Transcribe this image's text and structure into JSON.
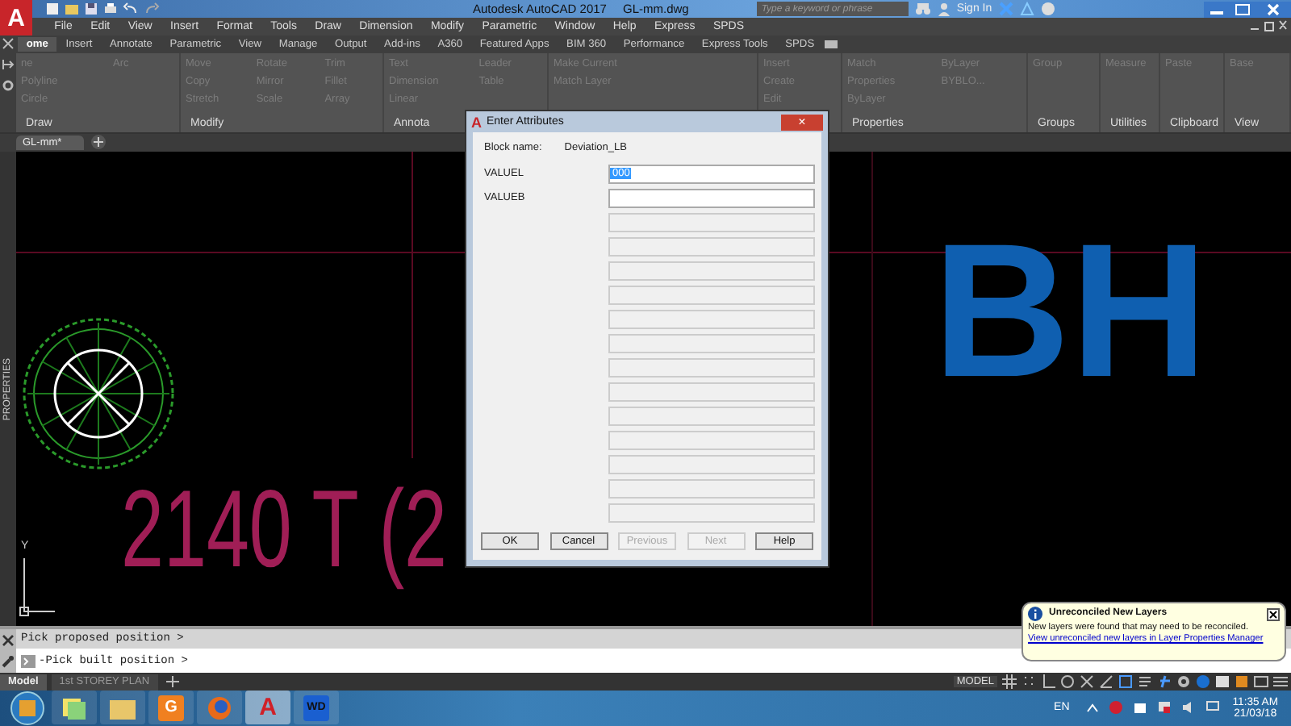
{
  "title_bar": {
    "logo": "A",
    "app_title": "Autodesk AutoCAD 2017",
    "file_name": "GL-mm.dwg",
    "search": {
      "placeholder": "Type a keyword or phrase"
    },
    "sign_in": "Sign In"
  },
  "menu_bar": [
    "File",
    "Edit",
    "View",
    "Insert",
    "Format",
    "Tools",
    "Draw",
    "Dimension",
    "Modify",
    "Parametric",
    "Window",
    "Help",
    "Express",
    "SPDS"
  ],
  "ribbon_tabs": [
    {
      "label": "ome",
      "selected": true
    },
    {
      "label": "Insert",
      "selected": false
    },
    {
      "label": "Annotate",
      "selected": false
    },
    {
      "label": "Parametric",
      "selected": false
    },
    {
      "label": "View",
      "selected": false
    },
    {
      "label": "Manage",
      "selected": false
    },
    {
      "label": "Output",
      "selected": false
    },
    {
      "label": "Add-ins",
      "selected": false
    },
    {
      "label": "A360",
      "selected": false
    },
    {
      "label": "Featured Apps",
      "selected": false
    },
    {
      "label": "BIM 360",
      "selected": false
    },
    {
      "label": "Performance",
      "selected": false
    },
    {
      "label": "Express Tools",
      "selected": false
    },
    {
      "label": "SPDS",
      "selected": false
    }
  ],
  "ribbon_panels": [
    {
      "title": "Draw",
      "tools": [
        "ne",
        "Polyline",
        "Circle",
        "Arc"
      ]
    },
    {
      "title": "Modify",
      "tools": [
        "Move",
        "Copy",
        "Stretch",
        "Rotate",
        "Mirror",
        "Scale",
        "Trim",
        "Fillet",
        "Array"
      ]
    },
    {
      "title": "Annota",
      "tools": [
        "Text",
        "Dimension",
        "Linear",
        "Leader",
        "Table"
      ]
    },
    {
      "tools": [
        "Make Current",
        "Match Layer"
      ]
    },
    {
      "tools": [
        "Insert",
        "Create",
        "Edit"
      ]
    },
    {
      "title": "Properties",
      "tools": [
        "Match",
        "Properties",
        "ByLayer",
        "ByLayer",
        "BYBLO..."
      ]
    },
    {
      "title": "Groups",
      "tools": [
        "Group"
      ]
    },
    {
      "title": "Utilities",
      "tools": [
        "Measure"
      ]
    },
    {
      "title": "Clipboard",
      "tools": [
        "Paste"
      ]
    },
    {
      "title": "View",
      "tools": [
        "Base"
      ]
    }
  ],
  "document_tabs": [
    {
      "label": "GL-mm*",
      "selected": true
    }
  ],
  "canvas": {
    "palette_label": "PROPERTIES",
    "label_text": "2140 T (2",
    "block_text": "BH",
    "ucs_y_label": "Y"
  },
  "dialog": {
    "logo": "A",
    "title": "Enter Attributes",
    "close": "×",
    "block_name_label": "Block name:",
    "block_name": "Deviation_LB",
    "fields": [
      {
        "label": "VALUEL",
        "value": "000",
        "value_selected": true,
        "disabled": false
      },
      {
        "label": "VALUEB",
        "disabled": false
      },
      {
        "disabled": true
      },
      {
        "disabled": true
      },
      {
        "disabled": true
      },
      {
        "disabled": true
      },
      {
        "disabled": true
      },
      {
        "disabled": true
      },
      {
        "disabled": true
      },
      {
        "disabled": true
      },
      {
        "disabled": true
      },
      {
        "disabled": true
      },
      {
        "disabled": true
      },
      {
        "disabled": true
      },
      {
        "disabled": true
      }
    ],
    "buttons": [
      {
        "label": "OK",
        "disabled": false
      },
      {
        "label": "Cancel",
        "disabled": false
      },
      {
        "label": "Previous",
        "disabled": true
      },
      {
        "label": "Next",
        "disabled": true
      },
      {
        "label": "Help",
        "disabled": false
      }
    ]
  },
  "command_line": {
    "history": "Pick proposed position >",
    "input": "-Pick built position >"
  },
  "layout_tabs": [
    {
      "label": "Model",
      "selected": true
    },
    {
      "label": "1st STOREY PLAN",
      "selected": false
    }
  ],
  "status_bar": {
    "model_label": "MODEL"
  },
  "notification": {
    "title": "Unreconciled New Layers",
    "message": "New layers were found that may need to be reconciled.",
    "link": "View unreconciled new layers in Layer Properties Manager"
  },
  "taskbar": {
    "apps": [
      {
        "kind": "notes",
        "selected": false
      },
      {
        "kind": "folder",
        "selected": false
      },
      {
        "kind": "pdf",
        "label": "G",
        "selected": false
      },
      {
        "kind": "browser",
        "selected": false
      },
      {
        "kind": "cad",
        "label": "A",
        "selected": true
      },
      {
        "kind": "wd",
        "label": "WD",
        "selected": false
      }
    ],
    "language": "EN",
    "time": "11:35 AM",
    "date": "21/03/18"
  }
}
